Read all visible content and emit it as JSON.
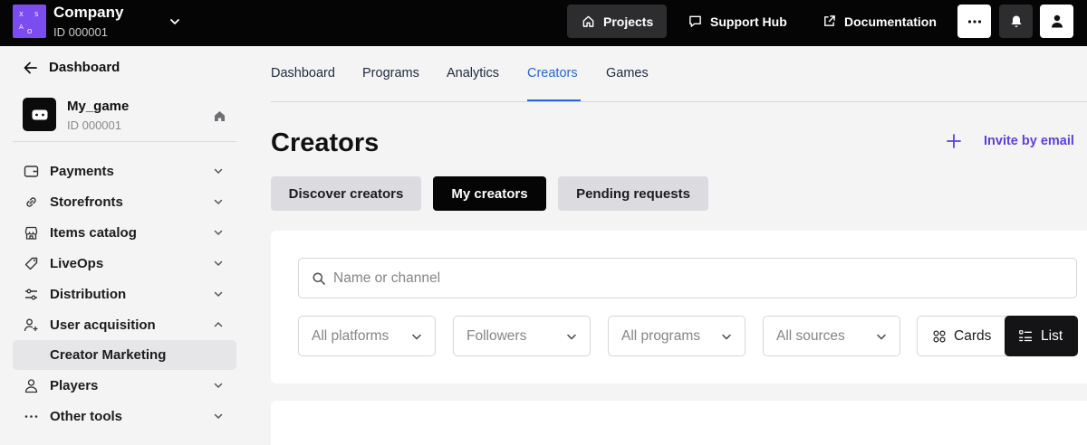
{
  "topbar": {
    "logo_letters": [
      "X",
      "S",
      "A",
      "O"
    ],
    "company_name": "Company",
    "company_id": "ID 000001",
    "projects_label": "Projects",
    "support_label": "Support Hub",
    "docs_label": "Documentation",
    "icons": {
      "company_chevron": "chevron-down-icon",
      "projects": "home-icon",
      "support": "chat-bubble-icon",
      "docs": "external-link-icon",
      "more": "more-dots-icon",
      "bell": "bell-icon",
      "user": "user-icon"
    }
  },
  "sidebar": {
    "back_label": "Dashboard",
    "game": {
      "name": "My_game",
      "id": "ID 000001",
      "icon": "gamepad-icon"
    },
    "items": [
      {
        "label": "Payments",
        "icon": "wallet-icon",
        "expanded": false
      },
      {
        "label": "Storefronts",
        "icon": "link-icon",
        "expanded": false
      },
      {
        "label": "Items catalog",
        "icon": "store-icon",
        "expanded": false
      },
      {
        "label": "LiveOps",
        "icon": "tag-icon",
        "expanded": false
      },
      {
        "label": "Distribution",
        "icon": "sliders-icon",
        "expanded": false
      },
      {
        "label": "User acquisition",
        "icon": "users-plus-icon",
        "expanded": true
      },
      {
        "label": "Creator Marketing",
        "sub": true,
        "active": true
      },
      {
        "label": "Players",
        "icon": "person-icon",
        "expanded": false
      },
      {
        "label": "Other tools",
        "icon": "dots-icon",
        "expanded": false
      }
    ]
  },
  "tabs": [
    {
      "label": "Dashboard",
      "active": false
    },
    {
      "label": "Programs",
      "active": false
    },
    {
      "label": "Analytics",
      "active": false
    },
    {
      "label": "Creators",
      "active": true
    },
    {
      "label": "Games",
      "active": false
    }
  ],
  "page": {
    "title": "Creators",
    "invite_label": "Invite by email"
  },
  "segments": {
    "discover": "Discover creators",
    "my": "My creators",
    "pending": "Pending requests",
    "selected": "My creators"
  },
  "search": {
    "placeholder": "Name or channel",
    "value": ""
  },
  "filters": [
    {
      "label": "All platforms"
    },
    {
      "label": "Followers"
    },
    {
      "label": "All programs"
    },
    {
      "label": "All sources"
    }
  ],
  "view": {
    "cards_label": "Cards",
    "list_label": "List",
    "selected": "List"
  },
  "colors": {
    "topbar_bg": "#050505",
    "logo_bg": "#7b4df0",
    "active_tab": "#2566d6",
    "invite": "#5b3fe0",
    "page_bg": "#f4f4f5"
  }
}
